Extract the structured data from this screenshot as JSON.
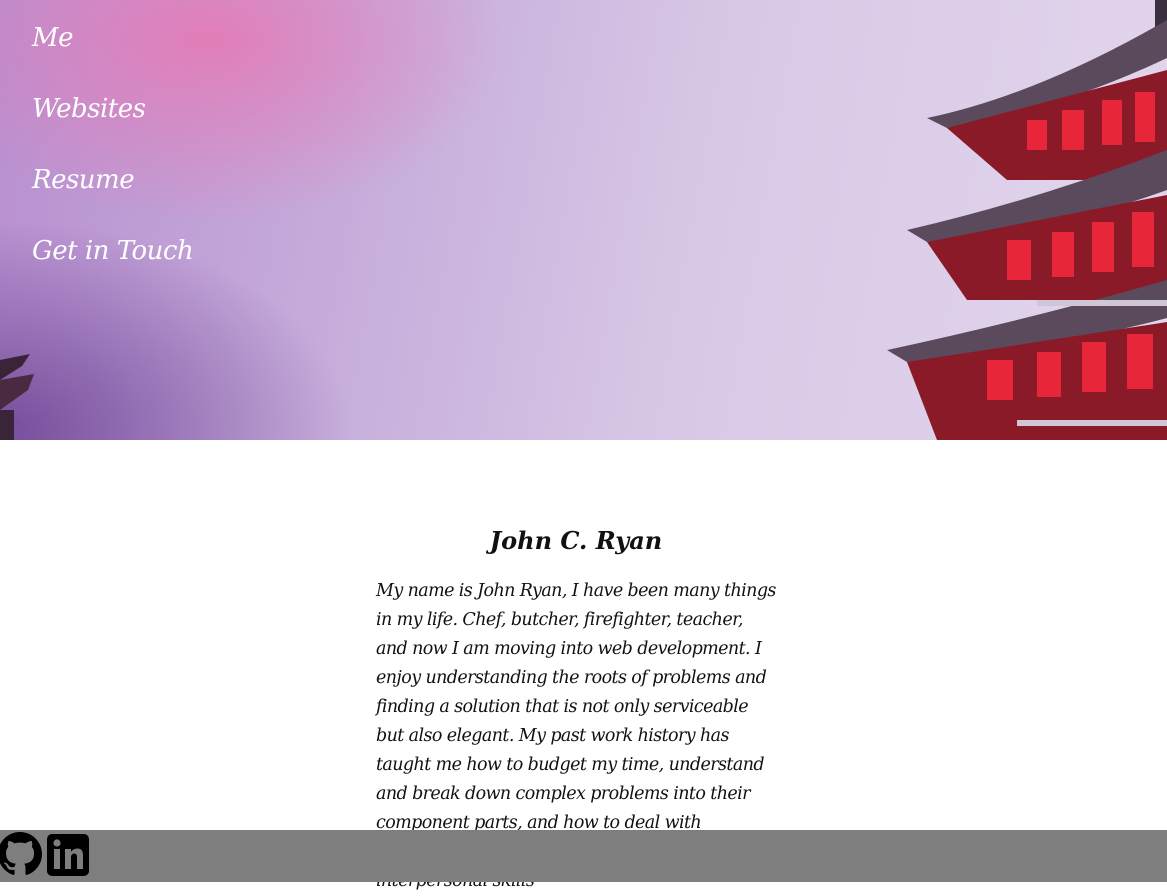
{
  "nav": {
    "items": [
      {
        "label": "Me"
      },
      {
        "label": "Websites"
      },
      {
        "label": "Resume"
      },
      {
        "label": "Get in Touch"
      }
    ]
  },
  "main": {
    "name": "John C. Ryan",
    "bio": "My name is John Ryan, I have been many things in my life. Chef, butcher, firefighter, teacher, and now I am moving into web development. I enjoy understanding the roots of problems and finding a solution that is not only serviceable but also elegant. My past work history has taught me how to budget my time, understand and break down complex problems into their component parts, and how to deal with pressure. I've also worked on improving my interpersonal skills"
  },
  "footer": {
    "icons": [
      "github-icon",
      "linkedin-icon"
    ],
    "background": "#7e7e7e"
  },
  "colors": {
    "hero_pink": "#e878b4",
    "hero_lavender": "#d8c8e6",
    "pagoda_red": "#b01828"
  }
}
